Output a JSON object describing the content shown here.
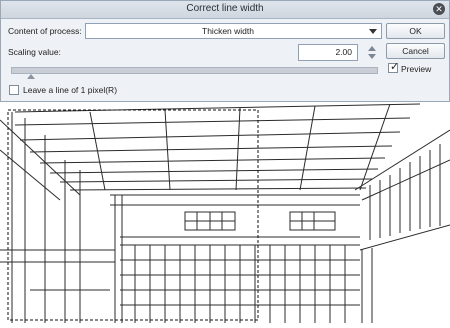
{
  "dialog": {
    "title": "Correct line width",
    "content_label": "Content of process:",
    "content_value": "Thicken width",
    "scaling_label": "Scaling value:",
    "scaling_value": "2.00",
    "ok_label": "OK",
    "cancel_label": "Cancel",
    "preview_label": "Preview",
    "preview_checked": true,
    "leave_line_label": "Leave a line of 1 pixel(R)",
    "leave_line_checked": false
  },
  "colors": {
    "dialog_bg": "#eef1f5",
    "line_art": "#2b2b2b"
  },
  "icons": {
    "close": "close-icon",
    "dropdown": "chevron-down-icon",
    "spin": "spin-arrows-icon"
  }
}
